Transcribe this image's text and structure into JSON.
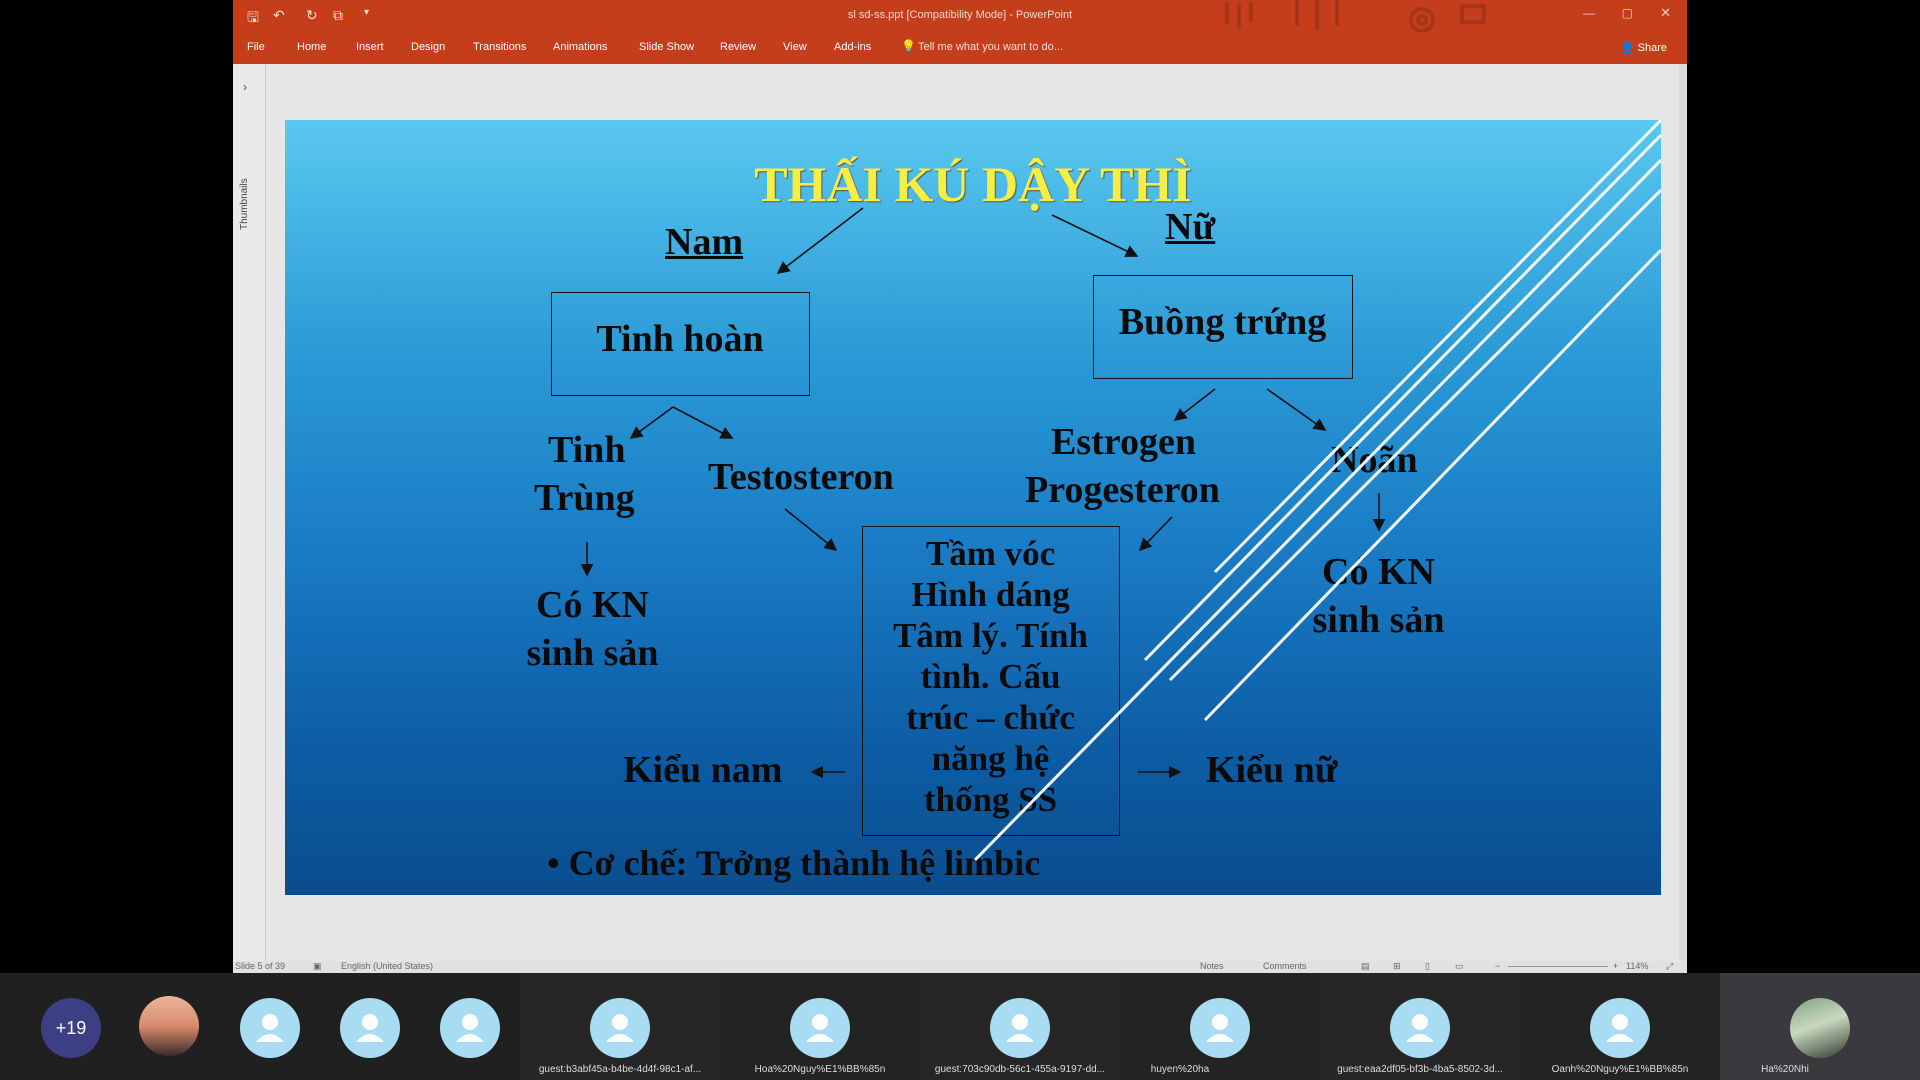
{
  "app": {
    "window_title": "sl sd-ss.ppt [Compatibility Mode] - PowerPoint",
    "ribbon_tabs": [
      "File",
      "Home",
      "Insert",
      "Design",
      "Transitions",
      "Animations",
      "Slide Show",
      "Review",
      "View",
      "Add-ins"
    ],
    "tell_me": "Tell me what you want to do...",
    "share_label": "Share",
    "thumbnails_label": "Thumbnails",
    "brand_color": "#c43e1c"
  },
  "status": {
    "slide_counter": "Slide 5 of 39",
    "language": "English (United States)",
    "notes": "Notes",
    "comments": "Comments",
    "zoom": "114%"
  },
  "slide": {
    "title": "THẤI KÚ DẬY THÌ",
    "nam": "Nam",
    "nu": "Nữ",
    "tinh_hoan": "Tinh hoàn",
    "buong_trung": "Buồng trứng",
    "tinh_trung_1": "Tinh",
    "tinh_trung_2": "Trùng",
    "testosteron": "Testosteron",
    "estrogen": "Estrogen",
    "progesteron": "Progesteron",
    "noan": "Noãn",
    "co_kn_left_1": "Có KN",
    "co_kn_left_2": "sinh sản",
    "co_kn_right_1": "Có KN",
    "co_kn_right_2": "sinh sản",
    "center_lines": [
      "Tầm vóc",
      "Hình dáng",
      "Tâm lý. Tính",
      "tình. Cấu",
      "trúc – chức",
      "năng  hệ",
      "thống SS"
    ],
    "kieu_nam": "Kiểu nam",
    "kieu_nu": "Kiểu nữ",
    "co_che": "• Cơ chế: Trởng thành hệ limbic"
  },
  "meeting": {
    "more_count": "+19",
    "participants": [
      {
        "name": "guest:b3abf45a-b4be-4d4f-98c1-af..."
      },
      {
        "name": "Hoa%20Nguy%E1%BB%85n"
      },
      {
        "name": "guest:703c90db-56c1-455a-9197-dd..."
      },
      {
        "name": "huyen%20ha"
      },
      {
        "name": "guest:eaa2df05-bf3b-4ba5-8502-3d..."
      },
      {
        "name": "Oanh%20Nguy%E1%BB%85n"
      },
      {
        "name": "Ha%20Nhi"
      }
    ]
  }
}
